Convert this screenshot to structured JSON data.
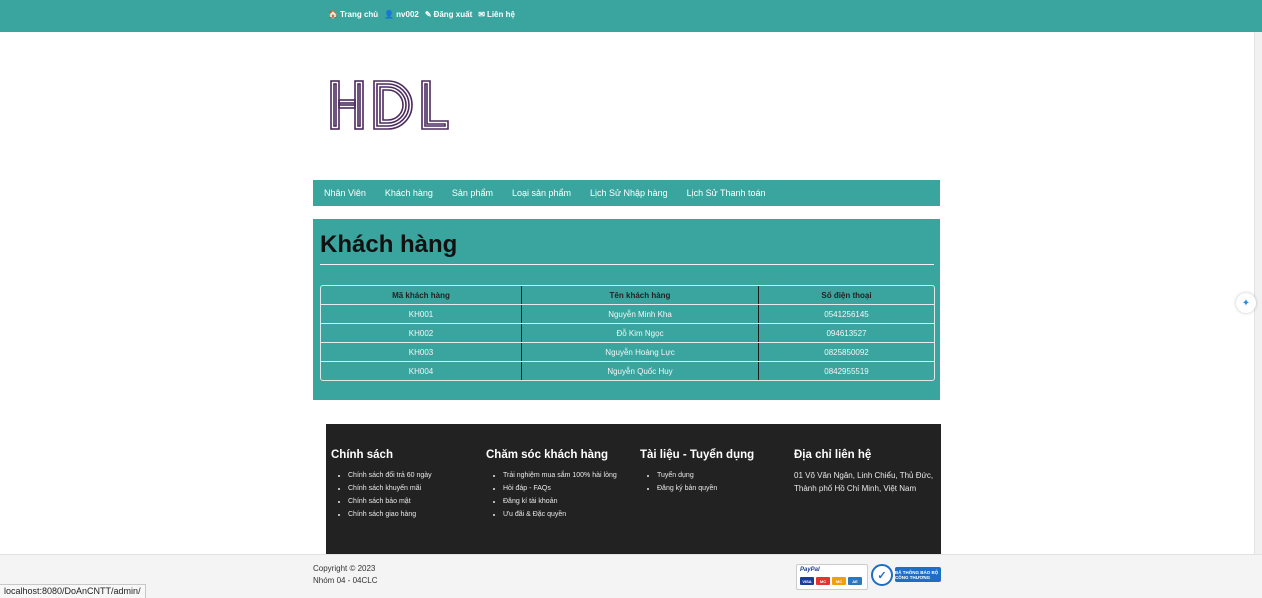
{
  "topnav": [
    {
      "icon": "home-icon",
      "glyph": "🏠",
      "label": "Trang chủ"
    },
    {
      "icon": "user-icon",
      "glyph": "👤",
      "label": "nv002"
    },
    {
      "icon": "edit-icon",
      "glyph": "✎",
      "label": "Đăng xuất"
    },
    {
      "icon": "mail-icon",
      "glyph": "✉",
      "label": "Liên hệ"
    }
  ],
  "logo": {
    "text": "HDL"
  },
  "mainnav": [
    "Nhân Viên",
    "Khách hàng",
    "Sản phẩm",
    "Loại sản phẩm",
    "Lịch Sử Nhập hàng",
    "Lịch Sử Thanh toán"
  ],
  "page_title": "Khách hàng",
  "table": {
    "headers": [
      "Mã khách hàng",
      "Tên khách hàng",
      "Số điện thoại"
    ],
    "rows": [
      [
        "KH001",
        "Nguyễn Minh Kha",
        "0541256145"
      ],
      [
        "KH002",
        "Đỗ Kim Ngọc",
        "094613527"
      ],
      [
        "KH003",
        "Nguyễn Hoàng Lực",
        "0825850092"
      ],
      [
        "KH004",
        "Nguyễn Quốc Huy",
        "0842955519"
      ]
    ]
  },
  "footer": {
    "col1": {
      "title": "Chính sách",
      "items": [
        "Chính sách đổi trả 60 ngày",
        "Chính sách khuyến mãi",
        "Chính sách bảo mật",
        "Chính sách giao hàng"
      ]
    },
    "col2": {
      "title": "Chăm sóc khách hàng",
      "items": [
        "Trải nghiệm mua sắm 100% hài lòng",
        "Hỏi đáp - FAQs",
        "Đăng kí tài khoản",
        "Ưu đãi & Đặc quyền"
      ]
    },
    "col3": {
      "title": "Tài liệu - Tuyển dụng",
      "items": [
        "Tuyển dụng",
        "Đăng ký bản quyền"
      ]
    },
    "col4": {
      "title": "Địa chỉ liên hệ",
      "text": "01 Võ Văn Ngân, Linh Chiểu, Thủ Đức, Thành phố Hồ Chí Minh, Việt Nam"
    }
  },
  "copyright": {
    "line1": "Copyright © 2023",
    "line2": "Nhóm 04 - 04CLC"
  },
  "badges": {
    "paypal": "PayPal",
    "cards": [
      "VISA",
      "MC",
      "MC",
      "AE"
    ],
    "registered": "ĐÃ THÔNG BÁO BỘ CÔNG THƯƠNG"
  },
  "status_url": "localhost:8080/DoAnCNTT/admin/",
  "colors": {
    "primary": "#3aa59f",
    "footer_bg": "#222222",
    "logo": "#4b2a5e"
  }
}
